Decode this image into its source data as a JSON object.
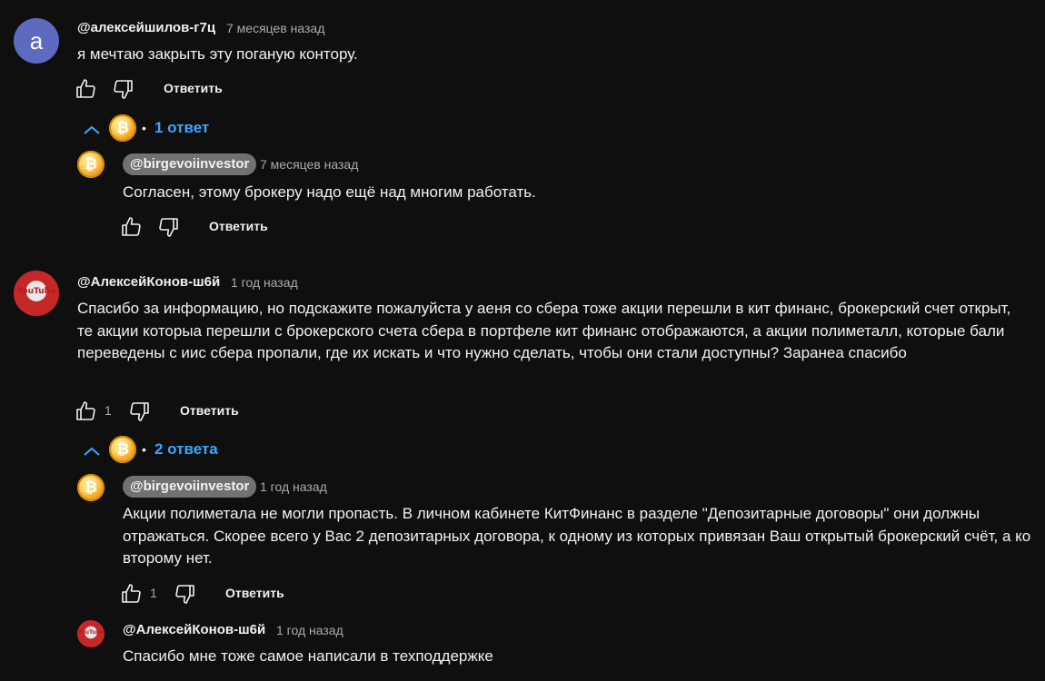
{
  "comments": [
    {
      "handle": "@алексейшилов-г7ц",
      "avatar_letter": "а",
      "time": "7 месяцев назад",
      "text": "я мечтаю закрыть эту поганую контору.",
      "reply_label": "Ответить",
      "replies_toggle": "1 ответ",
      "replies": [
        {
          "handle": "@birgevoiinvestor",
          "time": "7 месяцев назад",
          "text": "Согласен, этому брокеру надо ещё над многим работать.",
          "reply_label": "Ответить"
        }
      ]
    },
    {
      "handle": "@АлексейКонов-ш6й",
      "avatar_text": "YouTube",
      "time": "1 год назад",
      "text": "Спасибо за информацию, но подскажите пожалуйста у аеня со сбера тоже акции перешли в кит финанс, брокерский счет открыт, те акции которыа перешли с брокерского счета сбера в портфеле кит финанс отображаются, а акции полиметалл, которые бали переведены с иис сбера пропали, где их искать и что нужно сделать, чтобы они стали доступны? Заранеа спасибо",
      "likes": "1",
      "reply_label": "Ответить",
      "replies_toggle": "2 ответа",
      "replies": [
        {
          "handle": "@birgevoiinvestor",
          "time": "1 год назад",
          "text": "Акции полиметала не могли пропасть. В личном кабинете КитФинанс в разделе \"Депозитарные договоры\" они должны отражаться. Скорее всего у Вас 2 депозитарных договора, к одному из которых привязан Ваш открытый брокерский счёт, а ко второму нет.",
          "likes": "1",
          "reply_label": "Ответить"
        },
        {
          "handle": "@АлексейКонов-ш6й",
          "time": "1 год назад",
          "text": "Спасибо мне тоже самое написали в техподдержке"
        }
      ]
    }
  ],
  "icons": {
    "coin_symbol": "₿",
    "dot": "•"
  },
  "colors": {
    "background": "#0f0f0f",
    "link": "#3ea6ff",
    "muted": "#aaaaaa",
    "avatar_letter_bg": "#5c6bc0",
    "channel_chip_bg": "#717171"
  }
}
